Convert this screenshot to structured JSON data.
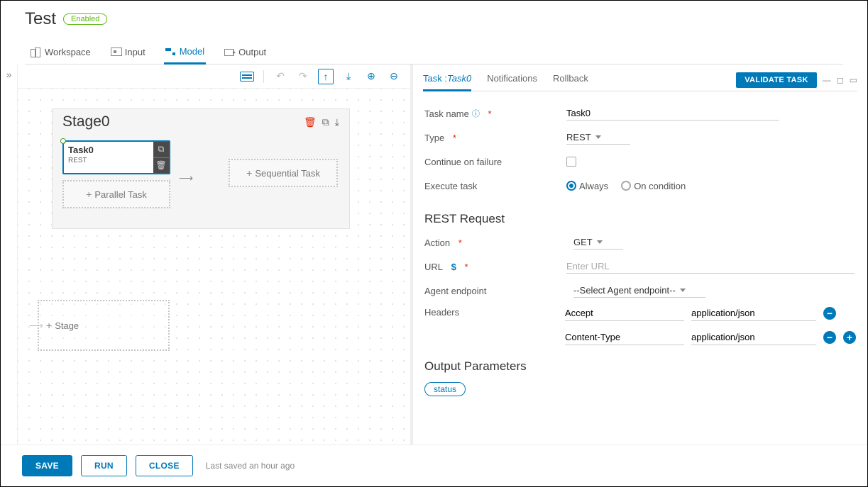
{
  "header": {
    "title": "Test",
    "status": "Enabled"
  },
  "tabs": {
    "workspace": "Workspace",
    "input": "Input",
    "model": "Model",
    "output": "Output"
  },
  "canvas": {
    "stage_title": "Stage0",
    "task": {
      "name": "Task0",
      "type": "REST"
    },
    "ph_parallel": "Parallel Task",
    "ph_seq": "Sequential Task",
    "ph_stage": "Stage"
  },
  "detail": {
    "tabs": {
      "task_prefix": "Task :",
      "task_name": "Task0",
      "notifications": "Notifications",
      "rollback": "Rollback"
    },
    "validate": "VALIDATE TASK",
    "fields": {
      "task_name_label": "Task name",
      "task_name_value": "Task0",
      "type_label": "Type",
      "type_value": "REST",
      "cof_label": "Continue on failure",
      "exec_label": "Execute task",
      "exec_always": "Always",
      "exec_cond": "On condition"
    },
    "rest": {
      "heading": "REST Request",
      "action_label": "Action",
      "action_value": "GET",
      "url_label": "URL",
      "url_placeholder": "Enter URL",
      "agent_label": "Agent endpoint",
      "agent_value": "--Select Agent endpoint--",
      "headers_label": "Headers",
      "headers": [
        {
          "key": "Accept",
          "value": "application/json"
        },
        {
          "key": "Content-Type",
          "value": "application/json"
        }
      ]
    },
    "output": {
      "heading": "Output Parameters",
      "chip": "status"
    }
  },
  "footer": {
    "save": "SAVE",
    "run": "RUN",
    "close": "CLOSE",
    "saved": "Last saved an hour ago"
  }
}
